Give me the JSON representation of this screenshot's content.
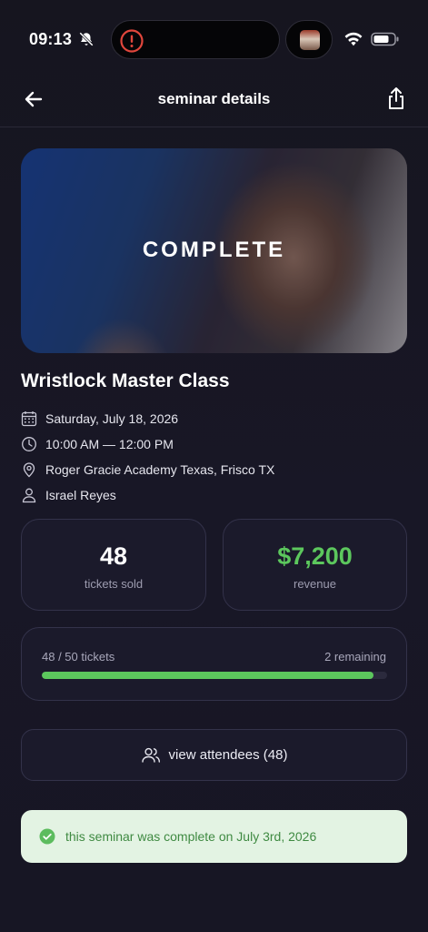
{
  "status_bar": {
    "time": "09:13",
    "icons": [
      "bell-slash-icon",
      "alert-icon",
      "wifi-icon",
      "battery-icon"
    ]
  },
  "nav": {
    "title": "seminar details",
    "back_icon": "arrow-left-icon",
    "share_icon": "share-icon"
  },
  "hero": {
    "status_label": "COMPLETE"
  },
  "seminar": {
    "title": "Wristlock Master Class",
    "date": "Saturday, July 18, 2026",
    "time": "10:00 AM — 12:00 PM",
    "location": "Roger Gracie Academy Texas, Frisco TX",
    "instructor": "Israel Reyes"
  },
  "stats": {
    "tickets_value": "48",
    "tickets_label": "tickets sold",
    "revenue_value": "$7,200",
    "revenue_label": "revenue"
  },
  "capacity": {
    "summary": "48 / 50 tickets",
    "remaining": "2 remaining",
    "sold": 48,
    "total": 50
  },
  "attendees_button": {
    "label": "view attendees (48)"
  },
  "banner": {
    "message": "this seminar was complete on July 3rd, 2026"
  },
  "colors": {
    "background": "#16151f",
    "card": "#1b1a2b",
    "accent_green": "#5cc75d",
    "banner_bg": "#e3f3e3",
    "banner_text": "#3f8a42",
    "alert_red": "#e0463c"
  }
}
